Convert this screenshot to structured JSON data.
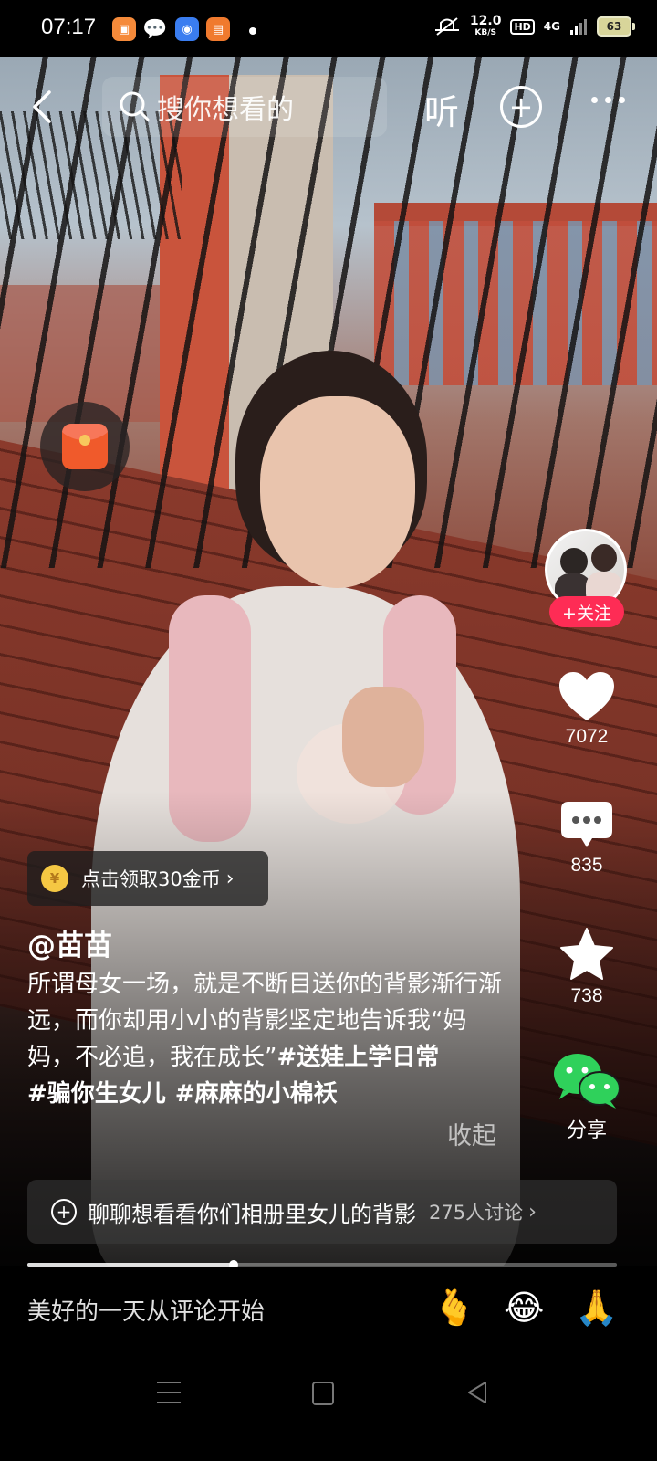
{
  "status_bar": {
    "time": "07:17",
    "speed_value": "12.0",
    "speed_unit": "KB/S",
    "hd_label": "HD",
    "network": "4G",
    "battery": "63"
  },
  "top_bar": {
    "search_placeholder": "搜你想看的",
    "listen_label": "听"
  },
  "creator": {
    "follow_label": "+关注",
    "handle": "@苗苗"
  },
  "actions": {
    "likes": "7072",
    "comments": "835",
    "favorites": "738",
    "share_label": "分享"
  },
  "coin_banner": {
    "icon_text": "¥",
    "label": "点击领取30金币"
  },
  "caption": {
    "text": "所谓母女一场，就是不断目送你的背影渐行渐远，而你却用小小的背影坚定地告诉我“妈妈，不必追，我在成长”",
    "hashtags": [
      "#送娃上学日常",
      "#骗你生女儿",
      "#麻麻的小棉袄"
    ],
    "collapse_label": "收起"
  },
  "topic": {
    "label": "聊聊想看看你们相册里女儿的背影",
    "count": "275人讨论"
  },
  "video_progress": 0.35,
  "comment_bar": {
    "placeholder": "美好的一天从评论开始",
    "emojis": [
      "🫰",
      "😂",
      "🙏"
    ]
  },
  "colors": {
    "accent": "#fe2c55",
    "share_green": "#2fd15b",
    "coin_gold": "#f5c743"
  }
}
